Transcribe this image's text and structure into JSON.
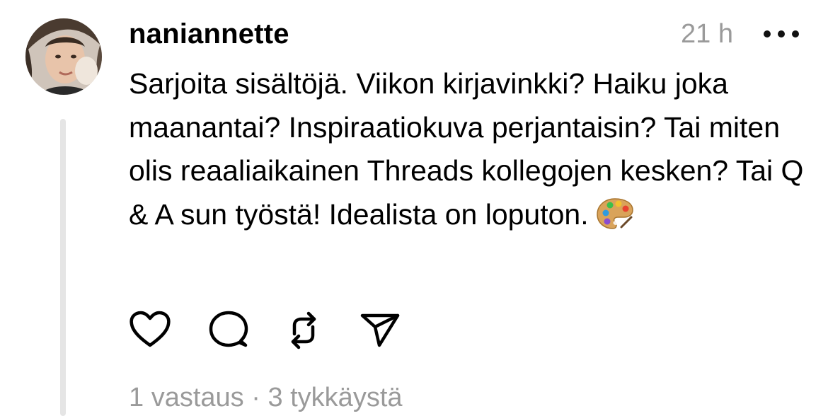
{
  "post": {
    "username": "naniannette",
    "timestamp": "21 h",
    "text": "Sarjoita sisältöjä. Viikon kirjavinkki? Haiku joka maanantai? Inspiraatiokuva perjantaisin? Tai miten olis reaaliaikainen Threads kollegojen kesken? Tai Q & A sun työstä! Idealista on loputon.",
    "emoji": "palette-emoji",
    "replies_label": "1 vastaus",
    "separator": " · ",
    "likes_label": "3 tykkäystä"
  },
  "icons": {
    "like": "heart-icon",
    "reply": "comment-icon",
    "repost": "repost-icon",
    "share": "send-icon",
    "more": "more-icon"
  },
  "colors": {
    "text": "#000000",
    "muted": "#9a9a9a",
    "thread_line": "#e5e5e5",
    "background": "#ffffff"
  }
}
